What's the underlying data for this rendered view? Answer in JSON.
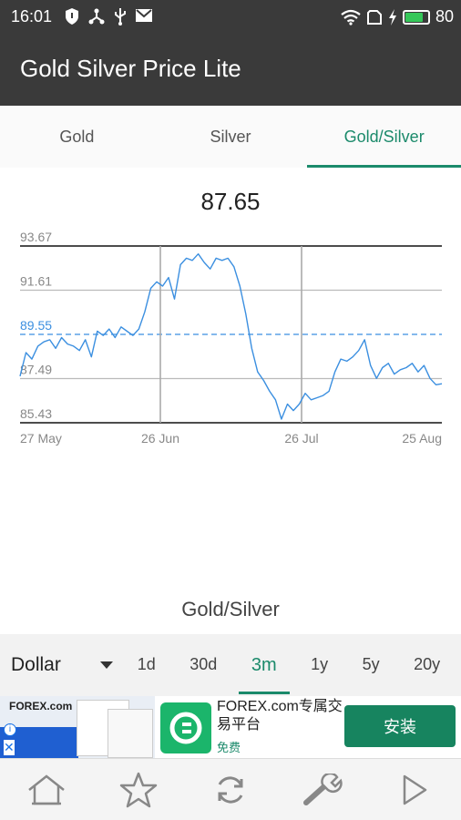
{
  "status_bar": {
    "time": "16:01",
    "battery_level": "80",
    "battery_fraction": 0.8
  },
  "app": {
    "title": "Gold Silver Price Lite"
  },
  "tabs": [
    {
      "label": "Gold",
      "active": false
    },
    {
      "label": "Silver",
      "active": false
    },
    {
      "label": "Gold/Silver",
      "active": true
    }
  ],
  "current_value": "87.65",
  "chart_caption": "Gold/Silver",
  "chart_data": {
    "type": "line",
    "title": "",
    "xlabel": "",
    "ylabel": "",
    "y_tick_labels": [
      "93.67",
      "91.61",
      "89.55",
      "87.49",
      "85.43"
    ],
    "y_ticks": [
      93.67,
      91.61,
      89.55,
      87.49,
      85.43
    ],
    "ylim": [
      85.43,
      93.67
    ],
    "x_tick_labels": [
      "27 May",
      "26 Jun",
      "26 Jul",
      "25 Aug"
    ],
    "reference_line": 89.55,
    "line_color": "#3b8fe0",
    "grid": true,
    "series": [
      {
        "values": [
          87.6,
          88.7,
          88.4,
          89.0,
          89.2,
          89.3,
          88.9,
          89.4,
          89.1,
          89.0,
          88.8,
          89.3,
          88.5,
          89.7,
          89.5,
          89.8,
          89.4,
          89.9,
          89.7,
          89.5,
          89.8,
          90.6,
          91.7,
          92.0,
          91.8,
          92.2,
          91.2,
          92.8,
          93.1,
          93.0,
          93.3,
          92.9,
          92.6,
          93.1,
          93.0,
          93.1,
          92.7,
          91.8,
          90.5,
          88.9,
          87.8,
          87.4,
          86.9,
          86.5,
          85.6,
          86.3,
          86.0,
          86.3,
          86.8,
          86.5,
          86.6,
          86.7,
          86.9,
          87.8,
          88.4,
          88.3,
          88.5,
          88.8,
          89.3,
          88.1,
          87.5,
          88.0,
          88.2,
          87.7,
          87.9,
          88.0,
          88.2,
          87.8,
          88.1,
          87.5,
          87.2,
          87.25
        ]
      }
    ]
  },
  "range_bar": {
    "currency": "Dollar",
    "ranges": [
      {
        "label": "1d",
        "active": false
      },
      {
        "label": "30d",
        "active": false
      },
      {
        "label": "3m",
        "active": true
      },
      {
        "label": "1y",
        "active": false
      },
      {
        "label": "5y",
        "active": false
      },
      {
        "label": "20y",
        "active": false
      }
    ]
  },
  "ad": {
    "logo_text": "FOREX.com",
    "title": "FOREX.com专属交易平台",
    "subtitle": "免费",
    "install_label": "安装",
    "info_glyph": "i",
    "close_glyph": "✕"
  },
  "bottom_nav": [
    {
      "icon": "home-icon"
    },
    {
      "icon": "star-icon"
    },
    {
      "icon": "refresh-icon"
    },
    {
      "icon": "wrench-icon"
    },
    {
      "icon": "play-icon"
    }
  ],
  "colors": {
    "accent": "#1b8a6b",
    "app_bar": "#3a3a3a",
    "line": "#3b8fe0"
  }
}
